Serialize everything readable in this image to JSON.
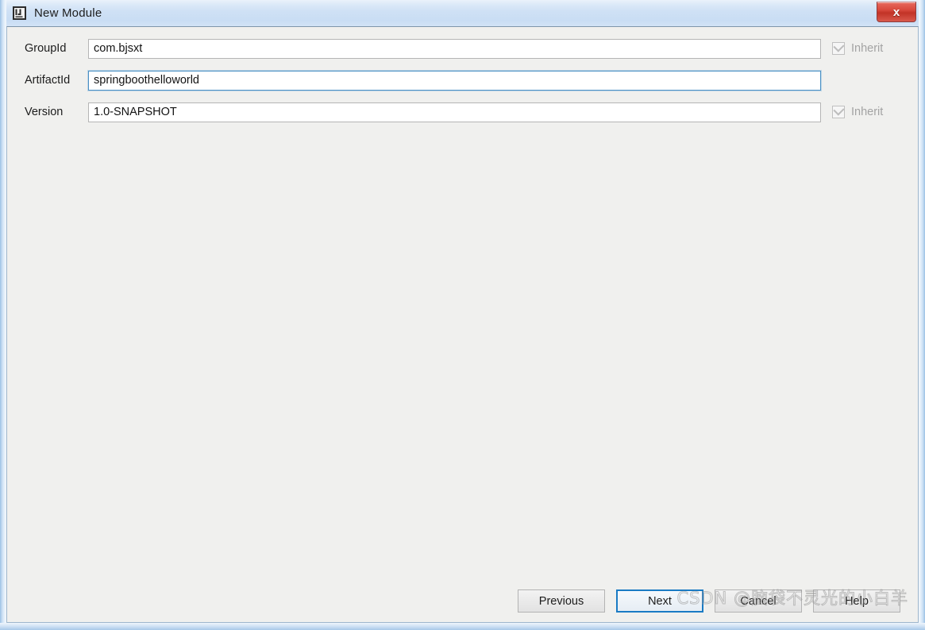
{
  "window": {
    "title": "New Module",
    "icon": "intellij-idea-icon",
    "close_label": "x",
    "accent_focus_color": "#1a7bc4",
    "titlebar_color": "#cfe1f5",
    "client_bg_color": "#f0f0ee",
    "close_button_color": "#c23327"
  },
  "form": {
    "rows": [
      {
        "label": "GroupId",
        "value": "com.bjsxt",
        "focused": false,
        "has_inherit": true,
        "inherit_label": "Inherit",
        "inherit_checked": true,
        "inherit_disabled": true
      },
      {
        "label": "ArtifactId",
        "value": "springboothelloworld",
        "focused": true,
        "has_inherit": false,
        "inherit_label": "",
        "inherit_checked": false,
        "inherit_disabled": false
      },
      {
        "label": "Version",
        "value": "1.0-SNAPSHOT",
        "focused": false,
        "has_inherit": true,
        "inherit_label": "Inherit",
        "inherit_checked": true,
        "inherit_disabled": true
      }
    ]
  },
  "buttons": [
    {
      "label": "Previous",
      "focused": false
    },
    {
      "label": "Next",
      "focused": true
    },
    {
      "label": "Cancel",
      "focused": false
    },
    {
      "label": "Help",
      "focused": false
    }
  ],
  "watermark": {
    "text": "CSDN @脑袋不灵光的小白羊"
  }
}
